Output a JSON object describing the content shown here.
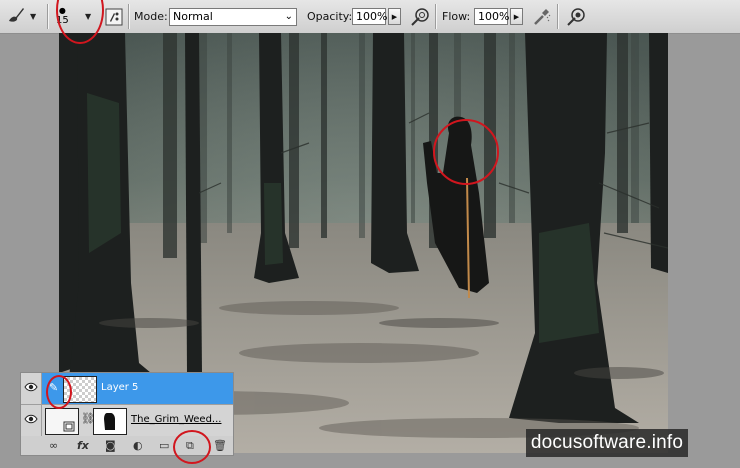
{
  "options_bar": {
    "brush_size": "15",
    "mode_label": "Mode:",
    "mode_value": "Normal",
    "opacity_label": "Opacity:",
    "opacity_value": "100%",
    "flow_label": "Flow:",
    "flow_value": "100%"
  },
  "layers_panel": {
    "layers": [
      {
        "name": "Layer 5",
        "selected": true
      },
      {
        "name": "The_Grim_Weed...",
        "selected": false
      }
    ]
  },
  "watermark": "docusoftware.info",
  "colors": {
    "selection_blue": "#3d98ea",
    "annotation_red": "#d1161e",
    "panel_gray": "#d4d4d4"
  }
}
